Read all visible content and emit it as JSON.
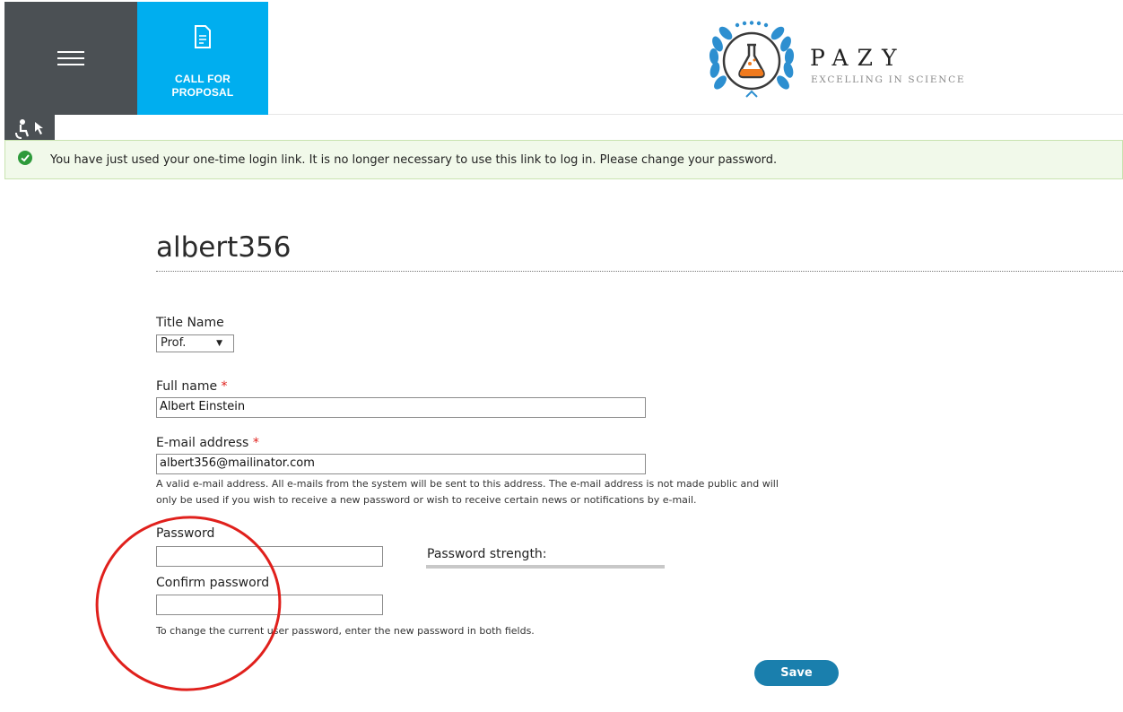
{
  "header": {
    "call_for_proposal": "CALL FOR PROPOSAL",
    "brand_name": "PAZY",
    "brand_tagline": "EXCELLING IN SCIENCE"
  },
  "message": {
    "text": "You have just used your one-time login link. It is no longer necessary to use this link to log in. Please change your password."
  },
  "form": {
    "username": "albert356",
    "title_label": "Title Name",
    "title_value": "Prof.",
    "fullname_label": "Full name",
    "fullname_value": "Albert Einstein",
    "email_label": "E-mail address",
    "email_value": "albert356@mailinator.com",
    "email_help_1": "A valid e-mail address. All e-mails from the system will be sent to this address. The e-mail address is not made public and will",
    "email_help_2": "only be used if you wish to receive a new password or wish to receive certain news or notifications by e-mail.",
    "password_label": "Password",
    "password_strength_label": "Password strength:",
    "confirm_label": "Confirm password",
    "password_help": "To change the current user password, enter the new password in both fields.",
    "required_marker": "*",
    "save_label": "Save"
  },
  "colors": {
    "header_dark": "#4b5054",
    "cfp_blue": "#00aeef",
    "message_bg": "#f1f9ea",
    "save_blue": "#1a7fad",
    "annotation_red": "#e0201c"
  },
  "icons": [
    "hamburger-icon",
    "document-icon",
    "logo-flask-icon",
    "accessibility-icon",
    "check-circle-icon",
    "dropdown-arrow-icon"
  ]
}
